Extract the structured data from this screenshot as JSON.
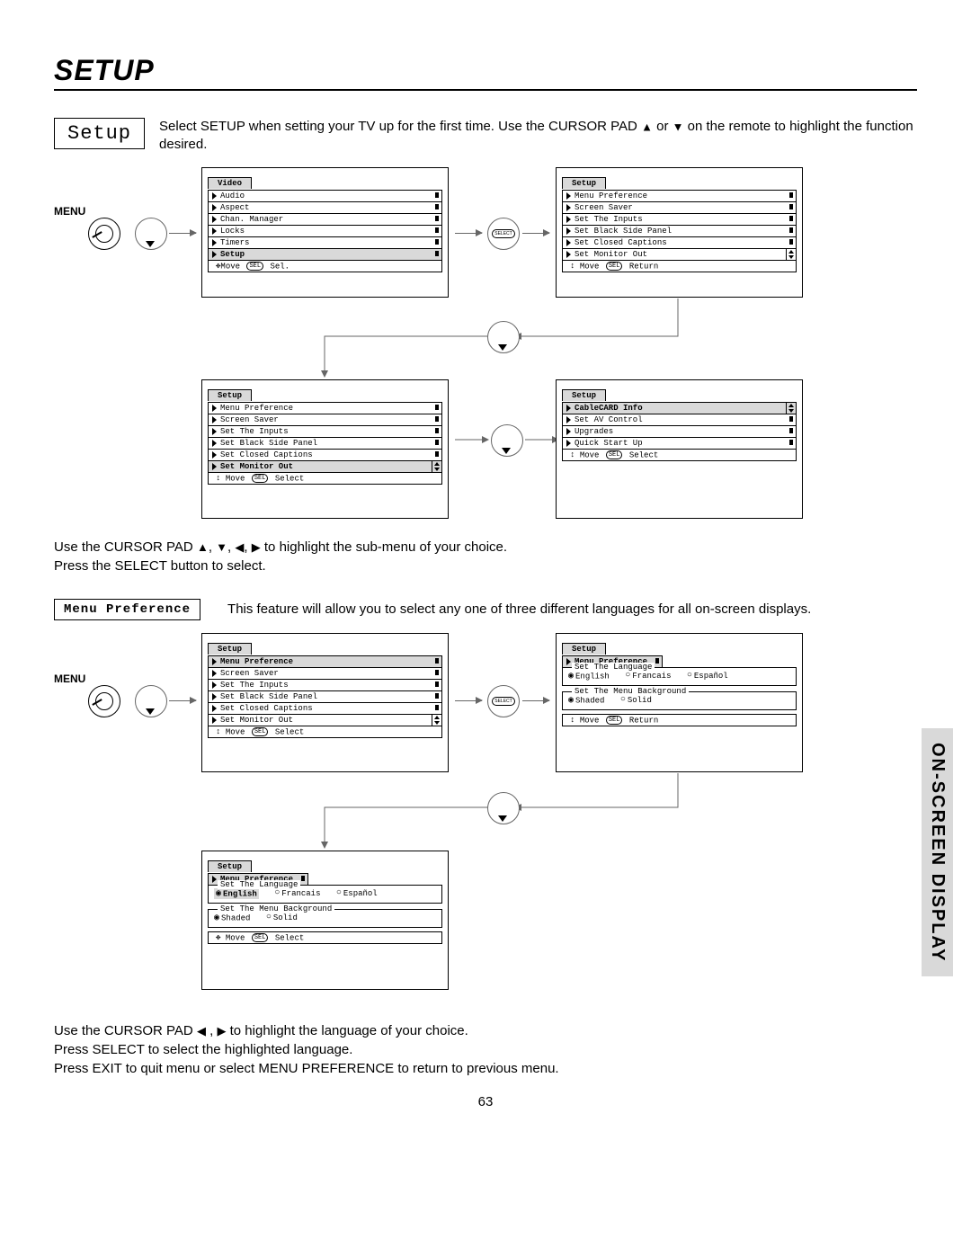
{
  "page": {
    "title": "SETUP",
    "number": "63",
    "tab": "ON-SCREEN DISPLAY"
  },
  "intro": {
    "box": "Setup",
    "text1": "Select SETUP when setting your TV up for the first time.  Use the CURSOR PAD ",
    "up": "▲",
    "or": " or ",
    "down": "▼",
    "text2": " on the remote to highlight the function desired."
  },
  "labels": {
    "menu": "MENU"
  },
  "osd1": {
    "tab": "Video",
    "items": [
      "Audio",
      "Aspect",
      "Chan. Manager",
      "Locks",
      "Timers",
      "Setup"
    ],
    "hl_index": 5,
    "foot_a": "Move",
    "foot_b": "Sel."
  },
  "osd2": {
    "tab": "Setup",
    "items": [
      "Menu Preference",
      "Screen Saver",
      "Set The Inputs",
      "Set Black Side Panel",
      "Set Closed Captions",
      "Set Monitor Out"
    ],
    "hl_index": -1,
    "foot_a": "Move",
    "foot_b": "Return"
  },
  "osd3": {
    "tab": "Setup",
    "items": [
      "Menu Preference",
      "Screen Saver",
      "Set The Inputs",
      "Set Black Side Panel",
      "Set Closed Captions",
      "Set Monitor Out"
    ],
    "hl_index": 5,
    "foot_a": "Move",
    "foot_b": "Select"
  },
  "osd4": {
    "tab": "Setup",
    "items": [
      "CableCARD Info",
      "Set AV Control",
      "Upgrades",
      "Quick Start Up"
    ],
    "hl_index": 0,
    "foot_a": "Move",
    "foot_b": "Select"
  },
  "mid": {
    "line1a": "Use the CURSOR PAD ",
    "aU": "▲",
    "c": ", ",
    "aD": "▼",
    "aL": "◀",
    "aR": "▶",
    "line1b": " to highlight the sub-menu of your choice.",
    "line2": "Press the SELECT button to select."
  },
  "mp": {
    "label": "Menu Preference",
    "text": "This feature will allow you to select any one of three different languages for all on-screen displays."
  },
  "osd5": {
    "tab": "Setup",
    "hl": "Menu Preference",
    "items": [
      "Screen Saver",
      "Set The Inputs",
      "Set Black Side Panel",
      "Set Closed Captions",
      "Set Monitor Out"
    ],
    "foot_a": "Move",
    "foot_b": "Select"
  },
  "osd6": {
    "tab": "Setup",
    "hl": "Menu Preference",
    "lang_title": "Set The Language",
    "lang": [
      "English",
      "Francais",
      "Español"
    ],
    "lang_sel": 0,
    "bg_title": "Set The Menu Background",
    "bg": [
      "Shaded",
      "Solid"
    ],
    "bg_sel": 0,
    "foot_a": "Move",
    "foot_b": "Return"
  },
  "osd7": {
    "tab": "Setup",
    "hl": "Menu Preference",
    "lang_title": "Set The Language",
    "lang": [
      "English",
      "Francais",
      "Español"
    ],
    "lang_sel": 0,
    "lang_hl": 0,
    "bg_title": "Set The Menu Background",
    "bg": [
      "Shaded",
      "Solid"
    ],
    "bg_sel": 0,
    "foot_a": "Move",
    "foot_b": "Select"
  },
  "end": {
    "l1a": "Use the CURSOR PAD ",
    "aL": "◀",
    "c": " , ",
    "aR": "▶",
    "l1b": " to highlight the language of your choice.",
    "l2": "Press SELECT to select the highlighted language.",
    "l3": "Press EXIT to quit menu or select MENU PREFERENCE to return to previous menu."
  }
}
